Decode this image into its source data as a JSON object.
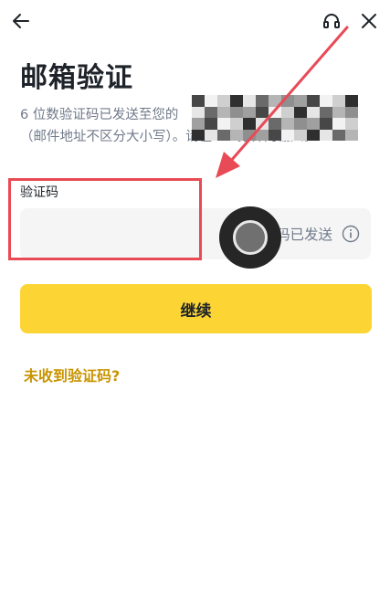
{
  "header": {
    "back_icon": "arrow-left-icon",
    "support_icon": "headset-icon",
    "close_icon": "close-icon"
  },
  "page": {
    "title": "邮箱验证",
    "desc_line1": "6 位数验证码已发送至您的",
    "desc_line2": "（邮件地址不区分大小写）。请在 30 分钟内输入。"
  },
  "code_field": {
    "label": "验证码",
    "value": "",
    "placeholder": "",
    "sent_status": "验证码已发送",
    "info_icon": "info-icon"
  },
  "actions": {
    "continue_label": "继续",
    "not_received_label": "未收到验证码?"
  },
  "colors": {
    "accent": "#fcd535",
    "link": "#c99400",
    "annotation": "#e84a56"
  }
}
